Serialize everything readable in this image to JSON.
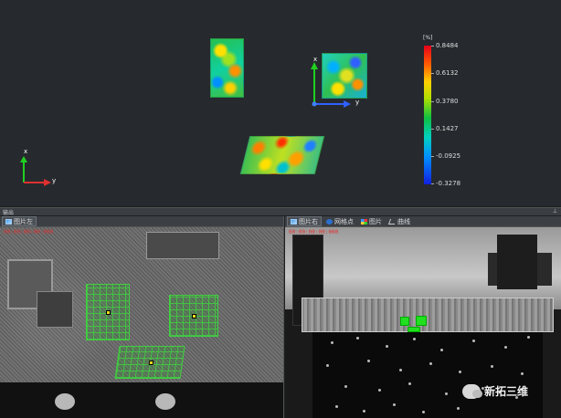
{
  "viewport": {
    "axis_labels": {
      "x": "x",
      "y": "y"
    },
    "scale": {
      "unit": "[%]",
      "ticks": [
        "0.8484",
        "0.6132",
        "0.3780",
        "0.1427",
        "-0.0925",
        "-0.3278"
      ],
      "colors": [
        "#e8001a",
        "#ffd000",
        "#10c040",
        "#00d0c0",
        "#1020e0"
      ]
    }
  },
  "output_panel": {
    "title": "输出",
    "pin_icon": "pin-icon"
  },
  "left_panel": {
    "tabs": [
      {
        "label": "图片左",
        "icon": "image-icon"
      }
    ],
    "timestamp": "00:00:00:00:000"
  },
  "right_panel": {
    "tabs": [
      {
        "label": "图片右",
        "icon": "image-icon"
      },
      {
        "label": "网格点",
        "icon": "grid-point-icon"
      },
      {
        "label": "图片",
        "icon": "picture-icon"
      },
      {
        "label": "曲线",
        "icon": "curve-icon"
      }
    ],
    "timestamp": "00:00:00:00:000"
  },
  "watermark": {
    "text": "新拓三维",
    "icon": "wechat-icon"
  }
}
